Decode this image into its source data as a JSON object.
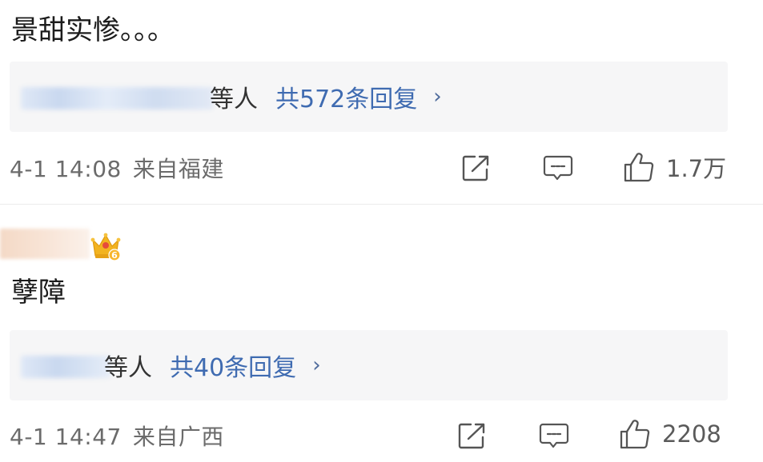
{
  "comments": [
    {
      "text": "景甜实惨。。。",
      "replies": {
        "who": "等人",
        "count_label": "共572条回复",
        "chevron": "›"
      },
      "meta": {
        "time": "4-1 14:08",
        "location": "来自福建"
      },
      "likes": "1.7万"
    },
    {
      "text": "孽障",
      "badge": {
        "level": "6",
        "icon": "crown-icon"
      },
      "replies": {
        "who": "等人",
        "count_label": "共40条回复",
        "chevron": "›"
      },
      "meta": {
        "time": "4-1 14:47",
        "location": "来自广西"
      },
      "likes": "2208"
    }
  ],
  "icons": {
    "share": "share-icon",
    "comment": "comment-icon",
    "like": "thumbs-up-icon"
  },
  "colors": {
    "link_blue": "#3f6bb1",
    "reply_bg": "#f6f6f7",
    "meta_gray": "#6b6b6b"
  }
}
